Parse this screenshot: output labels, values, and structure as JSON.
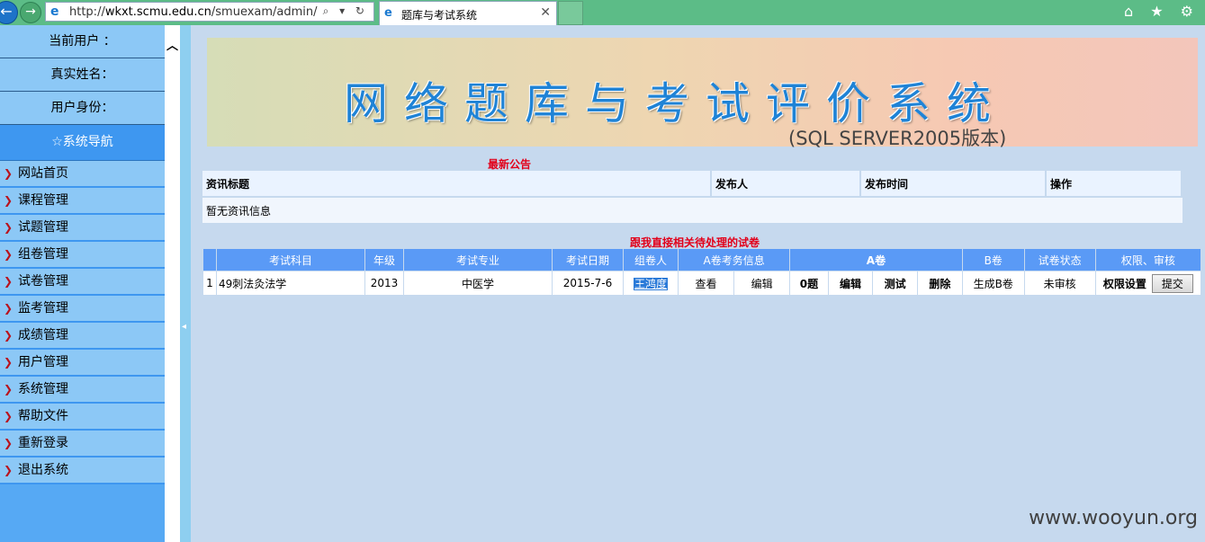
{
  "browser": {
    "back_glyph": "←",
    "forward_glyph": "→",
    "url_prefix": "http://",
    "url_host": "wkxt.scmu.edu.cn",
    "url_path": "/smuexam/admin/",
    "address_controls": "⌕ ▾ ↻",
    "tab_title": "题库与考试系统",
    "tab_close": "✕",
    "toolbar_icons": "⌂ ★ ⚙"
  },
  "sidebar": {
    "current_user_label": "当前用户 ：",
    "real_name_label": "真实姓名：",
    "identity_label": "用户身份：",
    "nav_header": "☆系统导航",
    "items": [
      {
        "label": "网站首页"
      },
      {
        "label": "课程管理"
      },
      {
        "label": "试题管理"
      },
      {
        "label": "组卷管理"
      },
      {
        "label": "试卷管理"
      },
      {
        "label": "监考管理"
      },
      {
        "label": "成绩管理"
      },
      {
        "label": "用户管理"
      },
      {
        "label": "系统管理"
      },
      {
        "label": "帮助文件"
      },
      {
        "label": "重新登录"
      },
      {
        "label": "退出系统"
      }
    ],
    "arrow_glyph": "❯",
    "scroll_up": "︿",
    "splitter_grip": "◂"
  },
  "banner": {
    "title": "网络题库与考试评价系统",
    "subtitle": "(SQL SERVER2005版本)"
  },
  "news": {
    "section_title": "最新公告",
    "headers": [
      "资讯标题",
      "发布人",
      "发布时间",
      "操作"
    ],
    "empty_message": "暂无资讯信息"
  },
  "exam": {
    "section_title": "跟我直接相关待处理的试卷",
    "headers": [
      "考试科目",
      "年级",
      "考试专业",
      "考试日期",
      "组卷人",
      "A卷考务信息",
      "A卷",
      "B卷",
      "试卷状态",
      "权限、审核"
    ],
    "row": {
      "index": "1",
      "subject": "49刺法灸法学",
      "grade": "2013",
      "major": "中医学",
      "date": "2015-7-6",
      "creator": "王鸿度",
      "view": "查看",
      "edit": "编辑",
      "a_count": "0题",
      "a_edit": "编辑",
      "a_test": "测试",
      "a_delete": "删除",
      "b_generate": "生成B卷",
      "status": "未审核",
      "permission": "权限设置",
      "submit": "提交"
    }
  },
  "watermark": "www.wooyun.org"
}
